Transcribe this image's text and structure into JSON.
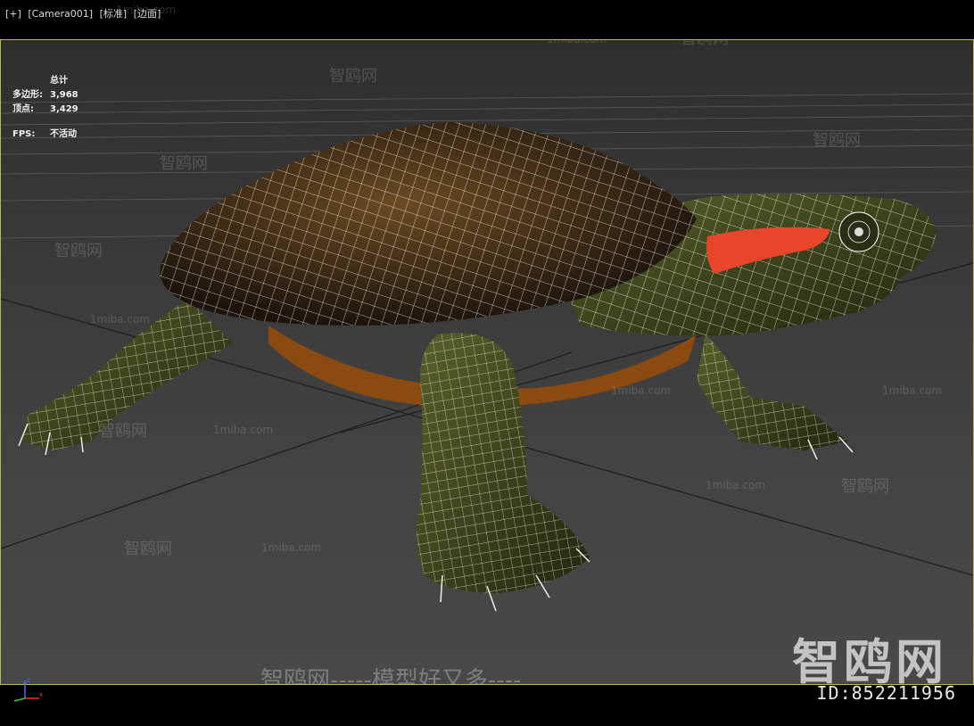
{
  "viewport": {
    "label_plus": "[+]",
    "label_camera": "[Camera001]",
    "label_shading": "[标准]",
    "label_mode": "[边面]"
  },
  "stats": {
    "title": "总计",
    "polys_label": "多边形:",
    "polys_value": "3,968",
    "verts_label": "顶点:",
    "verts_value": "3,429",
    "fps_label": "FPS:",
    "fps_value": "不活动"
  },
  "watermarks": {
    "site": "智鸥网",
    "domain": "1miba.com",
    "slogan": "智鸥网-----模型好又多----",
    "brand": "智鸥网",
    "id": "ID:852211956"
  },
  "colors": {
    "viewport_border": "#b9b94a",
    "shell": "#4a3418",
    "skin": "#3c4218",
    "red_stripe": "#e8452a",
    "wire": "#ffffff"
  }
}
